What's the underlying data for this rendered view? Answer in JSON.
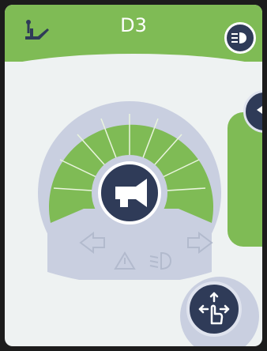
{
  "screen": {
    "title": "D3",
    "colors": {
      "accent": "#7fbb55",
      "button_dark": "#2f3b58",
      "lavender": "#c9cfe0",
      "background": "#eef2f2"
    }
  },
  "icons": {
    "seat": "seat-adjust-icon",
    "lights": "headlight-icon",
    "nav": "arrow-left-icon",
    "horn": "horn-icon",
    "indicator_left": "arrow-left-outline-icon",
    "indicator_right": "arrow-right-outline-icon",
    "hazard": "hazard-triangle-icon",
    "dipped_beam": "dipped-beam-icon",
    "drive": "drive-hand-icon"
  }
}
